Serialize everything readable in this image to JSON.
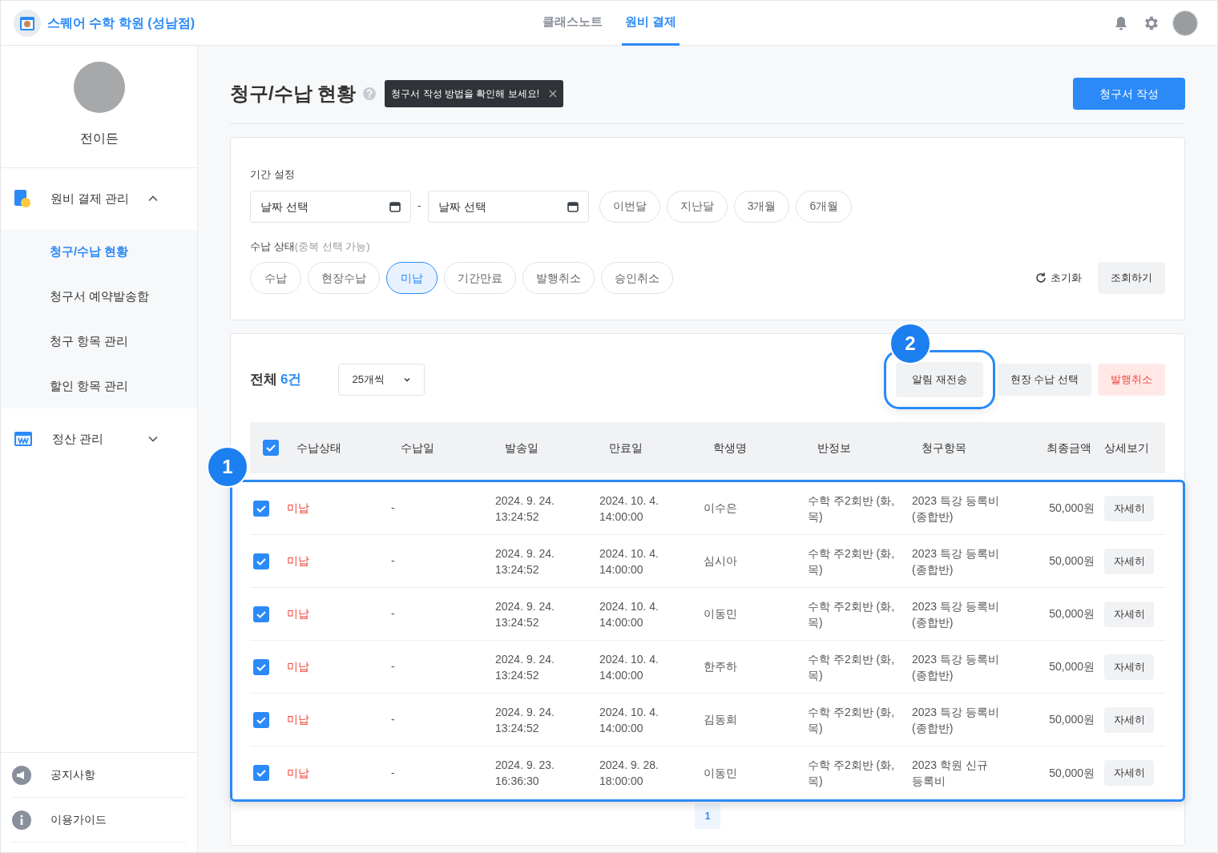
{
  "header": {
    "academy_name": "스퀘어 수학 학원 (성남점)",
    "tabs": [
      {
        "label": "클래스노트",
        "selected": false
      },
      {
        "label": "원비 결제",
        "selected": true
      }
    ]
  },
  "sidebar": {
    "profile_name": "전이든",
    "groups": [
      {
        "label": "원비 결제 관리",
        "expanded": true,
        "children": [
          {
            "label": "청구/수납 현황",
            "selected": true
          },
          {
            "label": "청구서 예약발송함",
            "selected": false
          },
          {
            "label": "청구 항목 관리",
            "selected": false
          },
          {
            "label": "할인 항목 관리",
            "selected": false
          }
        ]
      },
      {
        "label": "정산 관리",
        "expanded": false
      }
    ],
    "footer_items": [
      {
        "label": "공지사항"
      },
      {
        "label": "이용가이드"
      }
    ]
  },
  "page": {
    "title": "청구/수납 현황",
    "tooltip": "청구서 작성 방법을 확인해 보세요!",
    "create_button": "청구서 작성"
  },
  "filters": {
    "period_label": "기간 설정",
    "date_from": {
      "placeholder": "날짜 선택"
    },
    "separator": "-",
    "date_to": {
      "placeholder": "날짜 선택"
    },
    "period_buttons": [
      "이번달",
      "지난달",
      "3개월",
      "6개월"
    ],
    "status_label": "수납 상태",
    "status_hint": "(중복 선택 가능)",
    "status_chips": [
      {
        "label": "수납",
        "selected": false
      },
      {
        "label": "현장수납",
        "selected": false
      },
      {
        "label": "미납",
        "selected": true
      },
      {
        "label": "기간만료",
        "selected": false
      },
      {
        "label": "발행취소",
        "selected": false
      },
      {
        "label": "승인취소",
        "selected": false
      }
    ],
    "reset_button": "초기화",
    "search_button": "조회하기"
  },
  "results": {
    "total_label": "전체",
    "total_count": "6건",
    "page_size": "25개씩",
    "actions": [
      {
        "label": "알림 재전송",
        "kind": "neutral",
        "highlighted": true
      },
      {
        "label": "현장 수납 선택",
        "kind": "neutral",
        "highlighted": false
      },
      {
        "label": "발행취소",
        "kind": "danger",
        "highlighted": false
      }
    ],
    "annotations": [
      {
        "number": "1"
      },
      {
        "number": "2"
      }
    ],
    "table": {
      "all_checked": true,
      "columns": [
        "수납상태",
        "수납일",
        "발송일",
        "만료일",
        "학생명",
        "반정보",
        "청구항목",
        "최종금액",
        "상세보기"
      ],
      "rows": [
        {
          "checked": true,
          "status": "미납",
          "paid": "-",
          "sent": "2024. 9. 24.",
          "sent_time": "13:24:52",
          "expiry": "2024. 10. 4.",
          "expiry_time": "14:00:00",
          "student": "이수은",
          "class": "수학 주2회반 (화, 목)",
          "item": "2023 특강 등록비 (종합반)",
          "amount": "50,000원",
          "detail": "자세히"
        },
        {
          "checked": true,
          "status": "미납",
          "paid": "-",
          "sent": "2024. 9. 24.",
          "sent_time": "13:24:52",
          "expiry": "2024. 10. 4.",
          "expiry_time": "14:00:00",
          "student": "심시아",
          "class": "수학 주2회반 (화, 목)",
          "item": "2023 특강 등록비 (종합반)",
          "amount": "50,000원",
          "detail": "자세히"
        },
        {
          "checked": true,
          "status": "미납",
          "paid": "-",
          "sent": "2024. 9. 24.",
          "sent_time": "13:24:52",
          "expiry": "2024. 10. 4.",
          "expiry_time": "14:00:00",
          "student": "이동민",
          "class": "수학 주2회반 (화, 목)",
          "item": "2023 특강 등록비 (종합반)",
          "amount": "50,000원",
          "detail": "자세히"
        },
        {
          "checked": true,
          "status": "미납",
          "paid": "-",
          "sent": "2024. 9. 24.",
          "sent_time": "13:24:52",
          "expiry": "2024. 10. 4.",
          "expiry_time": "14:00:00",
          "student": "한주하",
          "class": "수학 주2회반 (화, 목)",
          "item": "2023 특강 등록비 (종합반)",
          "amount": "50,000원",
          "detail": "자세히"
        },
        {
          "checked": true,
          "status": "미납",
          "paid": "-",
          "sent": "2024. 9. 24.",
          "sent_time": "13:24:52",
          "expiry": "2024. 10. 4.",
          "expiry_time": "14:00:00",
          "student": "김동희",
          "class": "수학 주2회반 (화, 목)",
          "item": "2023 특강 등록비 (종합반)",
          "amount": "50,000원",
          "detail": "자세히"
        },
        {
          "checked": true,
          "status": "미납",
          "paid": "-",
          "sent": "2024. 9. 23.",
          "sent_time": "16:36:30",
          "expiry": "2024. 9. 28.",
          "expiry_time": "18:00:00",
          "student": "이동민",
          "class": "수학 주2회반 (화, 목)",
          "item": "2023 학원 신규 등록비",
          "amount": "50,000원",
          "detail": "자세히"
        }
      ]
    },
    "pagination": [
      {
        "label": "1",
        "selected": true
      }
    ]
  }
}
